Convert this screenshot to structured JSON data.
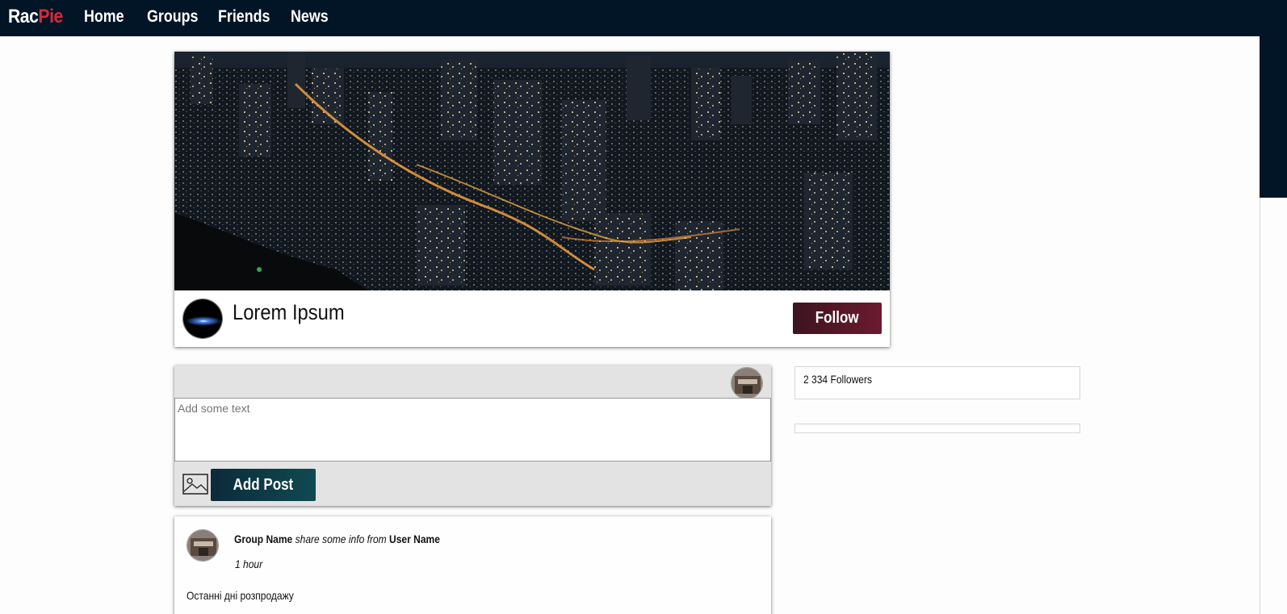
{
  "nav": {
    "brand_part1": "Rac",
    "brand_part2": "Pie",
    "links": [
      "Home",
      "Groups",
      "Friends",
      "News"
    ]
  },
  "profile": {
    "name": "Lorem Ipsum",
    "follow_label": "Follow"
  },
  "composer": {
    "placeholder": "Add some text",
    "add_post_label": "Add Post"
  },
  "post": {
    "group_name": "Group Name",
    "share_text": "share some info from",
    "user_name": "User Name",
    "time": "1 hour",
    "body": "Останні дні розпродажу"
  },
  "side": {
    "followers": "2 334 Followers"
  },
  "colors": {
    "nav_bg": "#021526",
    "brand_accent": "#d8293b",
    "follow_button": "#5a1728",
    "add_post_button": "#0e3a45"
  }
}
